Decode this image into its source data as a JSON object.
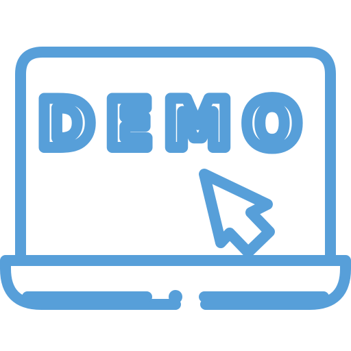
{
  "icon": {
    "name": "laptop-demo-icon",
    "stroke_color": "#579fd9",
    "background_color": "#ffffff"
  },
  "screen": {
    "text": "DEMO"
  },
  "cursor": {
    "name": "arrow-cursor-icon"
  }
}
